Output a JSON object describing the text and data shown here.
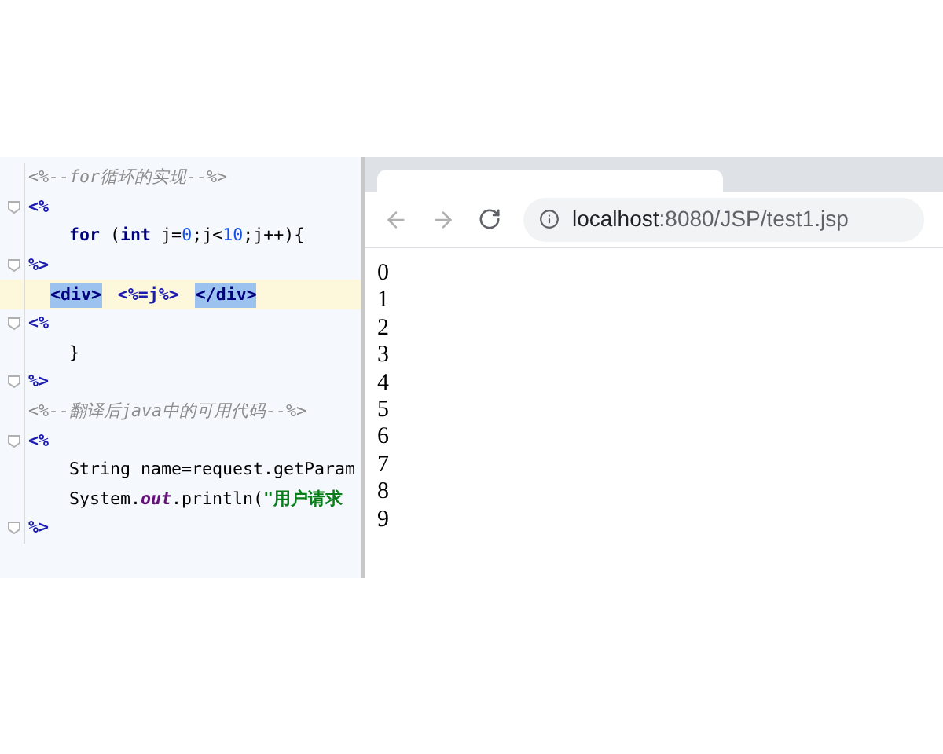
{
  "editor": {
    "lines": [
      {
        "fold": false,
        "current": false,
        "kind": "top",
        "segments": [
          {
            "kind": "comment",
            "text": "<%--for循环的实现--%>"
          }
        ]
      },
      {
        "fold": true,
        "current": false,
        "kind": "top",
        "segments": [
          {
            "kind": "directive",
            "text": "<%"
          }
        ]
      },
      {
        "fold": false,
        "current": false,
        "kind": "body",
        "segments": [
          {
            "kind": "keyword",
            "text": "for"
          },
          {
            "kind": "plain",
            "text": " ("
          },
          {
            "kind": "keyword",
            "text": "int"
          },
          {
            "kind": "plain",
            "text": " j="
          },
          {
            "kind": "number",
            "text": "0"
          },
          {
            "kind": "plain",
            "text": ";j<"
          },
          {
            "kind": "number",
            "text": "10"
          },
          {
            "kind": "plain",
            "text": ";j++){"
          }
        ]
      },
      {
        "fold": true,
        "current": false,
        "kind": "top",
        "segments": [
          {
            "kind": "directive",
            "text": "%>"
          }
        ]
      },
      {
        "fold": false,
        "current": true,
        "kind": "markup",
        "segments": [
          {
            "kind": "tag",
            "text": "<div>"
          },
          {
            "kind": "directive",
            "text": "<%=j%>"
          },
          {
            "kind": "tag",
            "text": "</div>"
          }
        ]
      },
      {
        "fold": true,
        "current": false,
        "kind": "top",
        "segments": [
          {
            "kind": "directive",
            "text": "<%"
          }
        ]
      },
      {
        "fold": false,
        "current": false,
        "kind": "body",
        "segments": [
          {
            "kind": "plain",
            "text": "}"
          }
        ]
      },
      {
        "fold": true,
        "current": false,
        "kind": "top",
        "segments": [
          {
            "kind": "directive",
            "text": "%>"
          }
        ]
      },
      {
        "fold": false,
        "current": false,
        "kind": "top",
        "segments": [
          {
            "kind": "comment",
            "text": "<%--翻译后java中的可用代码--%>"
          }
        ]
      },
      {
        "fold": true,
        "current": false,
        "kind": "top",
        "segments": [
          {
            "kind": "directive",
            "text": "<%"
          }
        ]
      },
      {
        "fold": false,
        "current": false,
        "kind": "body",
        "segments": [
          {
            "kind": "plain",
            "text": "String name=request.getParam"
          }
        ]
      },
      {
        "fold": false,
        "current": false,
        "kind": "body",
        "segments": [
          {
            "kind": "plain",
            "text": "System."
          },
          {
            "kind": "field",
            "text": "out"
          },
          {
            "kind": "plain",
            "text": ".println("
          },
          {
            "kind": "string",
            "text": "\"用户请求"
          }
        ]
      },
      {
        "fold": true,
        "current": false,
        "kind": "top",
        "segments": [
          {
            "kind": "directive",
            "text": "%>"
          }
        ]
      }
    ]
  },
  "browser": {
    "address": {
      "host": "localhost",
      "rest": ":8080/JSP/test1.jsp"
    },
    "output": [
      "0",
      "1",
      "2",
      "3",
      "4",
      "5",
      "6",
      "7",
      "8",
      "9"
    ]
  }
}
